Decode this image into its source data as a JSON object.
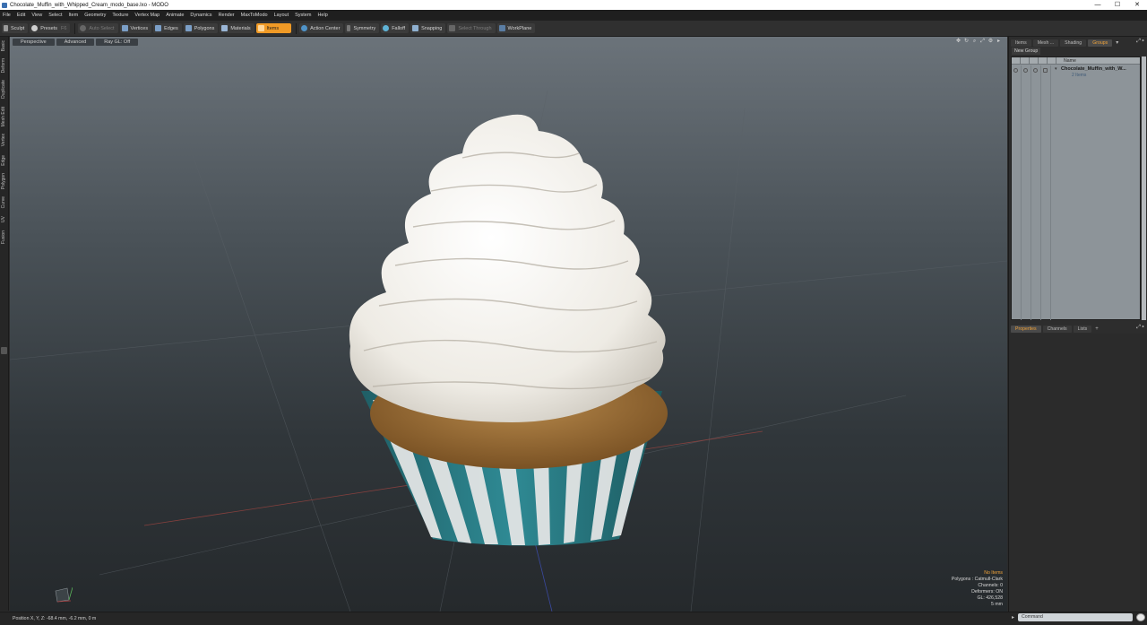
{
  "window": {
    "title": "Chocolate_Muffin_with_Whipped_Cream_modo_base.lxo - MODO",
    "minimize": "—",
    "maximize": "☐",
    "close": "✕"
  },
  "menu": [
    "File",
    "Edit",
    "View",
    "Select",
    "Item",
    "Geometry",
    "Texture",
    "Vertex Map",
    "Animate",
    "Dynamics",
    "Render",
    "MaxToModo",
    "Layout",
    "System",
    "Help"
  ],
  "toolbar": {
    "sculpt": "Sculpt",
    "presets": "Presets",
    "presets_key": "F6",
    "auto_select": "Auto Select",
    "vertices": "Vertices",
    "edges": "Edges",
    "polygons": "Polygons",
    "materials": "Materials",
    "items": "Items",
    "action_center": "Action Center",
    "symmetry": "Symmetry",
    "falloff": "Falloff",
    "snapping": "Snapping",
    "select_through": "Select Through",
    "workplane": "WorkPlane"
  },
  "left_tabs": [
    "Basic",
    "Deform",
    "Duplicate",
    "Mesh Edit",
    "Vertex",
    "Edge",
    "Polygon",
    "Curve",
    "UV",
    "Fusion"
  ],
  "viewport": {
    "tabs": [
      "Perspective",
      "Advanced",
      "Ray GL: Off"
    ],
    "stats": {
      "no_items": "No Items",
      "polygons": "Polygons : Catmull-Clark",
      "channels": "Channels: 0",
      "deformers": "Deformers: ON",
      "gl": "GL: 426,528",
      "unit": "5 mm"
    }
  },
  "right_panel": {
    "tabs": [
      "Items",
      "Mesh ...",
      "Shading",
      "Groups"
    ],
    "active_tab": "Groups",
    "new_group": "New Group",
    "column_name": "Name",
    "group_name": "Chocolate_Muffin_with_W...",
    "group_sub": "2 Items",
    "props_tabs": [
      "Properties",
      "Channels",
      "Lists"
    ],
    "props_active": "Properties",
    "add_tab": "+"
  },
  "statusbar": {
    "position": "Position X, Y, Z:  -68.4 mm, -6.2 mm, 0 m"
  },
  "command": {
    "placeholder": "Command"
  },
  "colors": {
    "accent": "#f09a26",
    "cup_teal": "#2a7b84",
    "cream": "#f2efe9"
  }
}
